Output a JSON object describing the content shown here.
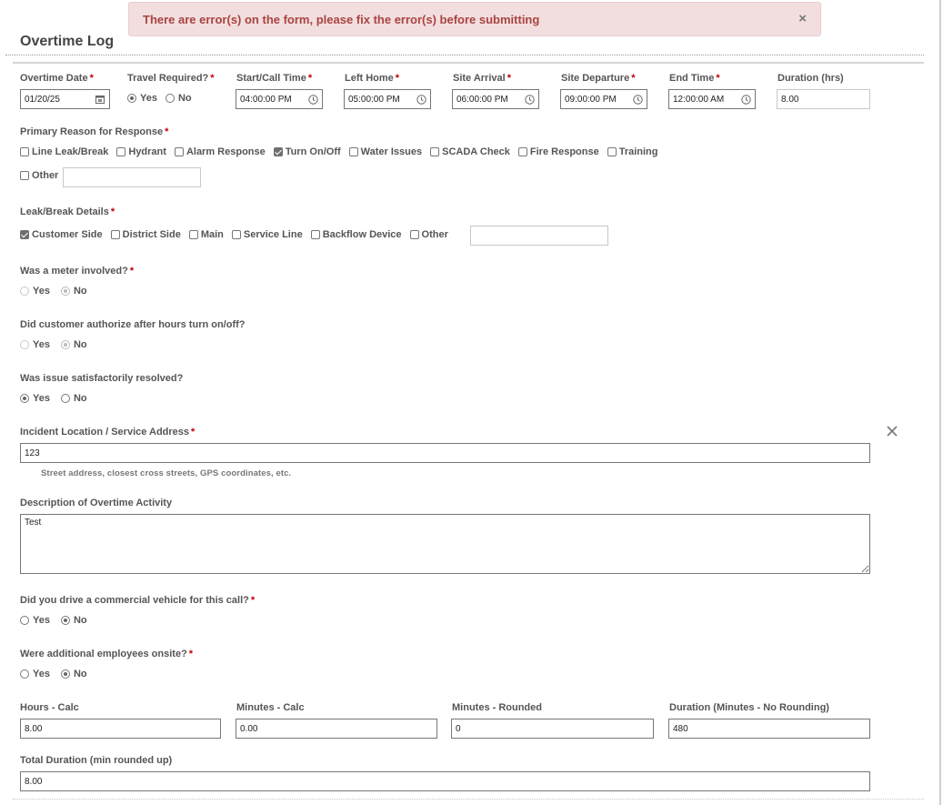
{
  "alert": {
    "message": "There are error(s) on the form, please fix the error(s) before submitting",
    "close_icon": "×"
  },
  "form": {
    "title": "Overtime Log",
    "required_marker": "*",
    "top_row": {
      "overtime_date": {
        "label": "Overtime Date",
        "value": "01/20/25",
        "icon": "calendar-icon"
      },
      "travel_required": {
        "label": "Travel Required?",
        "options": [
          "Yes",
          "No"
        ],
        "selected": "Yes"
      },
      "start_call_time": {
        "label": "Start/Call Time",
        "value": "04:00:00 PM",
        "icon": "clock-icon"
      },
      "left_home": {
        "label": "Left Home",
        "value": "05:00:00 PM",
        "icon": "clock-icon"
      },
      "site_arrival": {
        "label": "Site Arrival",
        "value": "06:00:00 PM",
        "icon": "clock-icon"
      },
      "site_departure": {
        "label": "Site Departure",
        "value": "09:00:00 PM",
        "icon": "clock-icon"
      },
      "end_time": {
        "label": "End Time",
        "value": "12:00:00 AM",
        "icon": "clock-icon"
      },
      "duration_hrs": {
        "label": "Duration (hrs)",
        "value": "8.00"
      }
    },
    "primary_reason": {
      "label": "Primary Reason for Response",
      "options": [
        {
          "label": "Line Leak/Break",
          "checked": false
        },
        {
          "label": "Hydrant",
          "checked": false
        },
        {
          "label": "Alarm Response",
          "checked": false
        },
        {
          "label": "Turn On/Off",
          "checked": true
        },
        {
          "label": "Water Issues",
          "checked": false
        },
        {
          "label": "SCADA Check",
          "checked": false
        },
        {
          "label": "Fire Response",
          "checked": false
        },
        {
          "label": "Training",
          "checked": false
        }
      ],
      "other_label": "Other",
      "other_checked": false,
      "other_value": ""
    },
    "leak_break_details": {
      "label": "Leak/Break Details",
      "options": [
        {
          "label": "Customer Side",
          "checked": true
        },
        {
          "label": "District Side",
          "checked": false
        },
        {
          "label": "Main",
          "checked": false
        },
        {
          "label": "Service Line",
          "checked": false
        },
        {
          "label": "Backflow Device",
          "checked": false
        }
      ],
      "other_label": "Other",
      "other_checked": false,
      "other_value": ""
    },
    "meter_involved": {
      "label": "Was a meter involved?",
      "options": [
        "Yes",
        "No"
      ],
      "selected": "No",
      "disabled": true
    },
    "customer_authorize": {
      "label": "Did customer authorize after hours turn on/off?",
      "options": [
        "Yes",
        "No"
      ],
      "selected": "No",
      "disabled": true
    },
    "issue_resolved": {
      "label": "Was issue satisfactorily resolved?",
      "options": [
        "Yes",
        "No"
      ],
      "selected": "Yes"
    },
    "incident_location": {
      "label": "Incident Location / Service Address",
      "value": "123",
      "hint": "Street address, closest cross streets, GPS coordinates, etc.",
      "clear_icon": "close-icon"
    },
    "description": {
      "label": "Description of Overtime Activity",
      "value": "Test"
    },
    "commercial_vehicle": {
      "label": "Did you drive a commercial vehicle for this call?",
      "options": [
        "Yes",
        "No"
      ],
      "selected": "No"
    },
    "additional_employees": {
      "label": "Were additional employees onsite?",
      "options": [
        "Yes",
        "No"
      ],
      "selected": "No"
    },
    "calc": {
      "hours_calc": {
        "label": "Hours - Calc",
        "value": "8.00"
      },
      "minutes_calc": {
        "label": "Minutes - Calc",
        "value": "0.00"
      },
      "minutes_rounded": {
        "label": "Minutes - Rounded",
        "value": "0"
      },
      "duration_no_rounding": {
        "label": "Duration (Minutes - No Rounding)",
        "value": "480"
      },
      "total_duration": {
        "label": "Total Duration (min rounded up)",
        "value": "8.00"
      }
    }
  }
}
